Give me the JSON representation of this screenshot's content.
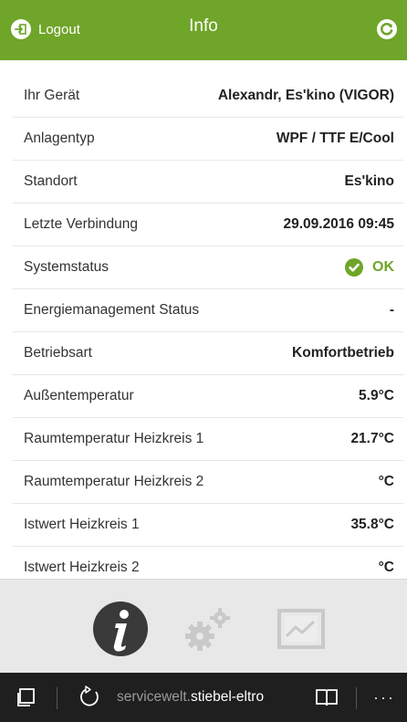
{
  "header": {
    "logout_label": "Logout",
    "title": "Info",
    "accent_color": "#6fa529"
  },
  "info": {
    "rows": [
      {
        "label": "Ihr Gerät",
        "value": "Alexandr, Es'kino (VIGOR)"
      },
      {
        "label": "Anlagentyp",
        "value": "WPF / TTF E/Cool"
      },
      {
        "label": "Standort",
        "value": "Es'kino"
      },
      {
        "label": "Letzte Verbindung",
        "value": "29.09.2016 09:45"
      },
      {
        "label": "Systemstatus",
        "value": "OK",
        "status_icon": "check-circle-icon"
      },
      {
        "label": "Energiemanagement Status",
        "value": "-"
      },
      {
        "label": "Betriebsart",
        "value": "Komfortbetrieb"
      },
      {
        "label": "Außentemperatur",
        "value": "5.9°C"
      },
      {
        "label": "Raumtemperatur Heizkreis 1",
        "value": "21.7°C"
      },
      {
        "label": "Raumtemperatur Heizkreis 2",
        "value": "°C"
      },
      {
        "label": "Istwert Heizkreis 1",
        "value": "35.8°C"
      },
      {
        "label": "Istwert Heizkreis 2",
        "value": "°C"
      }
    ]
  },
  "app_nav": {
    "items": [
      {
        "icon": "info-icon",
        "active": true
      },
      {
        "icon": "settings-gears-icon",
        "active": false
      },
      {
        "icon": "chart-icon",
        "active": false
      }
    ]
  },
  "browser": {
    "url_prefix": "servicewelt.",
    "url_domain": "stiebel-eltro",
    "more_label": "···"
  }
}
